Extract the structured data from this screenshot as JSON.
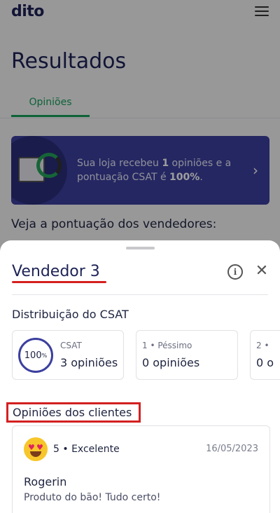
{
  "app": {
    "logo": "dito"
  },
  "page": {
    "title": "Resultados",
    "tab": "Opiniões"
  },
  "banner": {
    "text_before": "Sua loja recebeu ",
    "count": "1",
    "text_middle": " opiniões e a pontuação CSAT é ",
    "percent": "100%",
    "text_after": "."
  },
  "vendedores_label": "Veja a pontuação dos vendedores:",
  "sheet": {
    "title": "Vendedor 3",
    "dist_title": "Distribuição do CSAT",
    "cards": [
      {
        "ring_value": "100",
        "ring_unit": "%",
        "small": "CSAT",
        "big": "3 opiniões"
      },
      {
        "small": "1 • Péssimo",
        "big": "0 opiniões"
      },
      {
        "small": "2 •",
        "big": "0 o"
      }
    ],
    "opinions_title": "Opiniões dos clientes",
    "review": {
      "emoji": "heart-eyes-emoji",
      "rating": "5 • Excelente",
      "date": "16/05/2023",
      "name": "Rogerin",
      "text": "Produto do bão! Tudo certo!"
    }
  },
  "colors": {
    "accent_green": "#17a05a",
    "banner_bg": "#3c3f9e",
    "title_navy": "#1d2356",
    "highlight_red": "#d42020"
  }
}
